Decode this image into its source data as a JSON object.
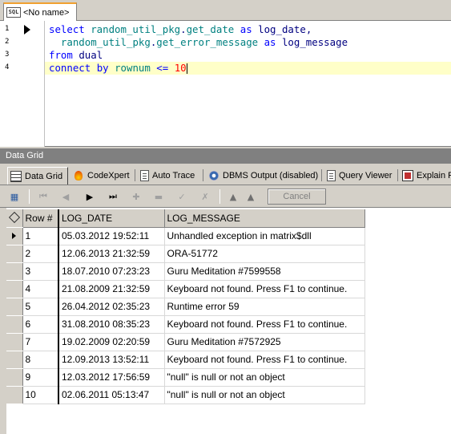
{
  "document_tab": {
    "label": "<No name>",
    "icon": "sql-file-icon"
  },
  "editor": {
    "line_numbers": [
      "1",
      "2",
      "3",
      "4"
    ],
    "lines": [
      [
        "select ",
        "random_util_pkg",
        ".",
        "get_date",
        " as ",
        "log_date",
        ","
      ],
      [
        "  ",
        "random_util_pkg",
        ".",
        "get_error_message",
        " as ",
        "log_message"
      ],
      [
        "from ",
        "dual"
      ],
      [
        "connect ",
        "by ",
        "rownum ",
        "<= ",
        "10"
      ]
    ]
  },
  "panel_title": "Data Grid",
  "result_tabs": [
    {
      "label": "Data Grid",
      "icon": "grid-icon"
    },
    {
      "label": "CodeXpert",
      "icon": "flame-icon"
    },
    {
      "label": "Auto Trace",
      "icon": "document-icon"
    },
    {
      "label": "DBMS Output (disabled)",
      "icon": "dbms-output-icon"
    },
    {
      "label": "Query Viewer",
      "icon": "document-icon"
    },
    {
      "label": "Explain Plan",
      "icon": "explain-plan-icon"
    }
  ],
  "toolbar": {
    "cancel_label": "Cancel"
  },
  "grid": {
    "columns": [
      "Row #",
      "LOG_DATE",
      "LOG_MESSAGE"
    ],
    "rows": [
      [
        "1",
        "05.03.2012 19:52:11",
        "Unhandled exception in matrix$dll"
      ],
      [
        "2",
        "12.06.2013 21:32:59",
        "ORA-51772"
      ],
      [
        "3",
        "18.07.2010 07:23:23",
        "Guru Meditation #7599558"
      ],
      [
        "4",
        "21.08.2009 21:32:59",
        "Keyboard not found. Press F1 to continue."
      ],
      [
        "5",
        "26.04.2012 02:35:23",
        "Runtime error 59"
      ],
      [
        "6",
        "31.08.2010 08:35:23",
        "Keyboard not found. Press F1 to continue."
      ],
      [
        "7",
        "19.02.2009 02:20:59",
        "Guru Meditation #7572925"
      ],
      [
        "8",
        "12.09.2013 13:52:11",
        "Keyboard not found. Press F1 to continue."
      ],
      [
        "9",
        "12.03.2012 17:56:59",
        "\"null\" is null or not an object"
      ],
      [
        "10",
        "02.06.2011 05:13:47",
        "\"null\" is null or not an object"
      ]
    ]
  }
}
